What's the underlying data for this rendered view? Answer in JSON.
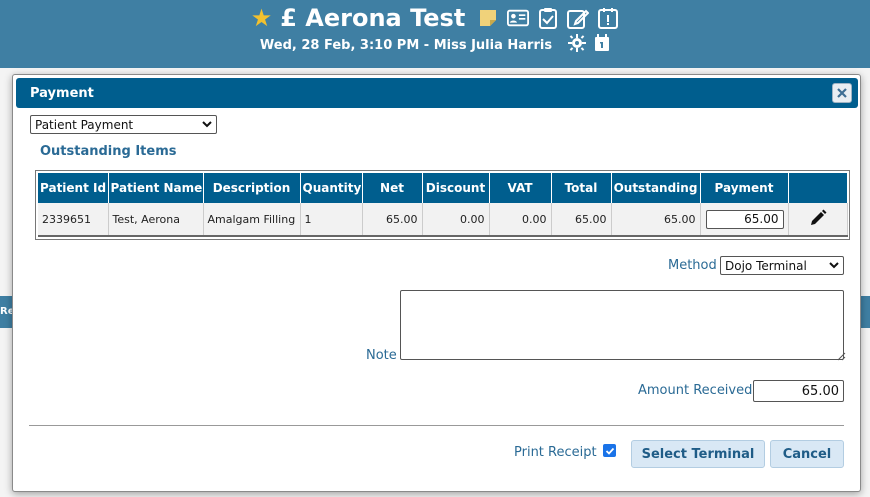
{
  "app_header": {
    "currency_symbol": "£",
    "patient_name": "Aerona Test",
    "appointment_info": "Wed, 28 Feb, 3:10 PM - Miss Julia Harris",
    "icons": [
      "star-icon",
      "sticky-note-icon",
      "id-card-icon",
      "clipboard-check-icon",
      "edit-icon",
      "alert-calendar-icon",
      "gear-icon",
      "calendar-icon"
    ]
  },
  "background": {
    "side_text": "Re"
  },
  "modal": {
    "title": "Payment",
    "close_icon": "close-icon",
    "payment_type": "Patient Payment",
    "section_title": "Outstanding Items",
    "table": {
      "headers": [
        "Patient Id",
        "Patient Name",
        "Description",
        "Quantity",
        "Net",
        "Discount",
        "VAT",
        "Total",
        "Outstanding",
        "Payment",
        ""
      ],
      "rows": [
        {
          "patient_id": "2339651",
          "patient_name": "Test, Aerona",
          "description": "Amalgam Filling",
          "quantity": "1",
          "net": "65.00",
          "discount": "0.00",
          "vat": "0.00",
          "total": "65.00",
          "outstanding": "65.00",
          "payment": "65.00",
          "edit_icon": "pencil-icon"
        }
      ]
    },
    "method_label": "Method",
    "method_value": "Dojo Terminal",
    "note_label": "Note",
    "note_value": "",
    "amount_label": "Amount Received",
    "amount_value": "65.00",
    "print_receipt_label": "Print Receipt",
    "print_receipt_checked": true,
    "select_terminal_label": "Select Terminal",
    "cancel_label": "Cancel"
  },
  "colors": {
    "header_bg": "#3f7fa3",
    "modal_titlebar": "#005e8e",
    "label_blue": "#2a6a95",
    "star": "#f2c12e",
    "button_bg": "#d9e8f5"
  }
}
